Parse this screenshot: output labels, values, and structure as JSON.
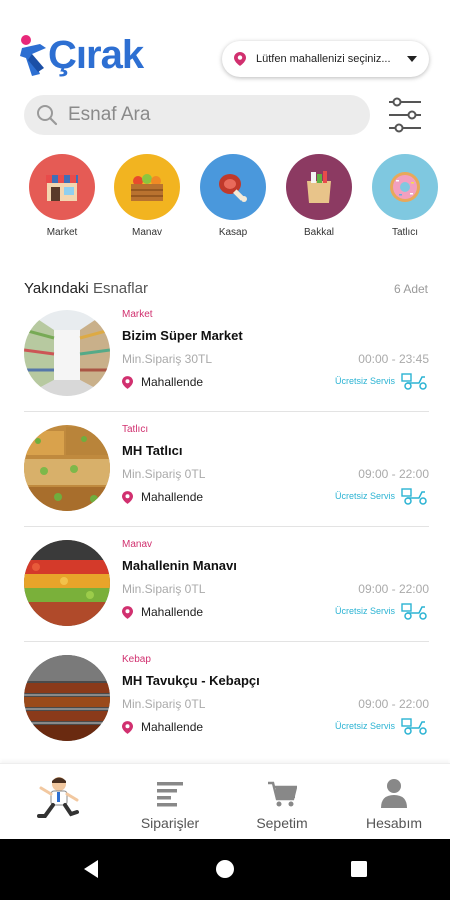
{
  "app": {
    "logo_text": "Çırak",
    "location_placeholder": "Lütfen mahallenizi seçiniz..."
  },
  "search": {
    "placeholder": "Esnaf Ara"
  },
  "categories": [
    {
      "label": "Market",
      "color": "#e55b55"
    },
    {
      "label": "Manav",
      "color": "#f2b420"
    },
    {
      "label": "Kasap",
      "color": "#4a98dc"
    },
    {
      "label": "Bakkal",
      "color": "#8c3a62"
    },
    {
      "label": "Tatlıcı",
      "color": "#7fc8e0"
    }
  ],
  "section": {
    "title_bold": "Yakındaki",
    "title_light": "Esnaflar",
    "count": "6 Adet"
  },
  "shops": [
    {
      "category": "Market",
      "name": "Bizim Süper Market",
      "min_order": "Min.Sipariş 30TL",
      "hours": "00:00 - 23:45",
      "location": "Mahallende",
      "service": "Ücretsiz Servis"
    },
    {
      "category": "Tatlıcı",
      "name": "MH Tatlıcı",
      "min_order": "Min.Sipariş 0TL",
      "hours": "09:00 - 22:00",
      "location": "Mahallende",
      "service": "Ücretsiz Servis"
    },
    {
      "category": "Manav",
      "name": "Mahallenin Manavı",
      "min_order": "Min.Sipariş 0TL",
      "hours": "09:00 - 22:00",
      "location": "Mahallende",
      "service": "Ücretsiz Servis"
    },
    {
      "category": "Kebap",
      "name": "MH Tavukçu - Kebapçı",
      "min_order": "Min.Sipariş 0TL",
      "hours": "09:00 - 22:00",
      "location": "Mahallende",
      "service": "Ücretsiz Servis"
    }
  ],
  "nav": {
    "orders": "Siparişler",
    "cart": "Sepetim",
    "account": "Hesabım"
  },
  "colors": {
    "brand": "#2d6fd2",
    "accent_pink": "#d1306f",
    "service_teal": "#2bb3d3"
  }
}
